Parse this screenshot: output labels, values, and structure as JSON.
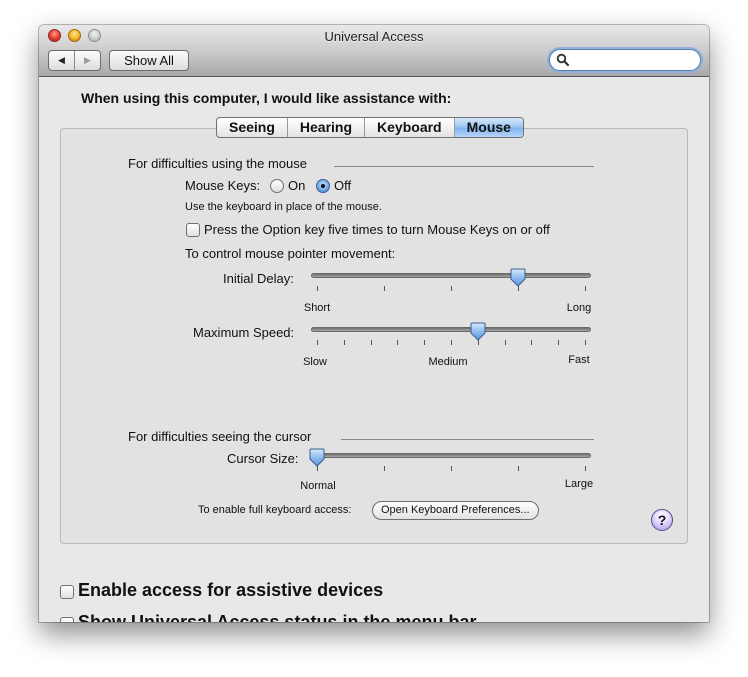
{
  "window": {
    "title": "Universal Access",
    "traffic_lights": [
      "close",
      "minimize",
      "zoom"
    ]
  },
  "toolbar": {
    "back_icon": "◀",
    "forward_icon": "▶",
    "show_all_label": "Show All",
    "search": {
      "value": "",
      "placeholder": "",
      "icon": "search-icon"
    }
  },
  "main": {
    "prompt": "When using this computer, I would like assistance with:",
    "tabs": [
      {
        "label": "Seeing",
        "active": false
      },
      {
        "label": "Hearing",
        "active": false
      },
      {
        "label": "Keyboard",
        "active": false
      },
      {
        "label": "Mouse",
        "active": true
      }
    ]
  },
  "mouse_section": {
    "heading": "For difficulties using the mouse",
    "mouse_keys": {
      "label": "Mouse Keys:",
      "options": [
        {
          "label": "On",
          "selected": false
        },
        {
          "label": "Off",
          "selected": true
        }
      ],
      "description": "Use the keyboard in place of the mouse."
    },
    "option_key_checkbox": {
      "label": "Press the Option key five times to turn Mouse Keys on or off",
      "checked": false
    },
    "pointer_heading": "To control mouse pointer movement:",
    "initial_delay": {
      "label": "Initial Delay:",
      "min_label": "Short",
      "max_label": "Long",
      "tick_count": 5,
      "value_fraction": 0.75
    },
    "maximum_speed": {
      "label": "Maximum Speed:",
      "min_label": "Slow",
      "mid_label": "Medium",
      "max_label": "Fast",
      "tick_count": 11,
      "value_fraction": 0.6
    }
  },
  "cursor_section": {
    "heading": "For difficulties seeing the cursor",
    "cursor_size": {
      "label": "Cursor Size:",
      "min_label": "Normal",
      "max_label": "Large",
      "tick_count": 5,
      "value_fraction": 0.0
    }
  },
  "keyboard_access": {
    "label": "To enable full keyboard access:",
    "button_label": "Open Keyboard Preferences..."
  },
  "help_label": "?",
  "bottom": {
    "assistive_devices": {
      "label": "Enable access for assistive devices",
      "checked": false
    },
    "status_menu": {
      "label": "Show Universal Access status in the menu bar",
      "checked": false
    }
  }
}
